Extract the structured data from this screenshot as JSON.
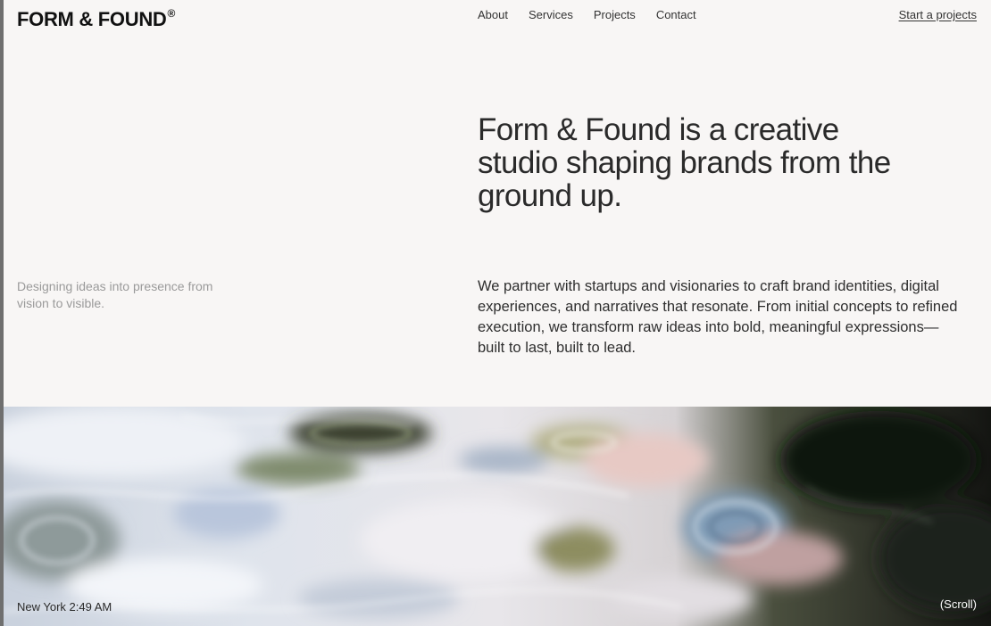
{
  "header": {
    "logo_text": "FORM & FOUND",
    "logo_mark": "®",
    "nav": [
      {
        "label": "About"
      },
      {
        "label": "Services"
      },
      {
        "label": "Projects"
      },
      {
        "label": "Contact"
      }
    ],
    "cta_label": "Start a projects"
  },
  "intro": {
    "headline": "Form & Found is a creative studio shaping brands from the ground up.",
    "tagline": "Designing ideas into presence from vision to visible.",
    "body": "We partner with startups and visionaries to craft brand identities, digital experiences, and narratives that resonate. From initial concepts to refined execution, we transform raw ideas into bold, meaningful expressions—built to last, built to lead."
  },
  "hero": {
    "image_subject": "abstract-water-ripples",
    "clock_text": "New York 2:49 AM",
    "scroll_hint": "(Scroll)"
  },
  "colors": {
    "page_background": "#f8f6f5",
    "frame": "#6f6f6f",
    "text_primary": "#2a2a2a",
    "text_muted": "#9a9a9a"
  }
}
